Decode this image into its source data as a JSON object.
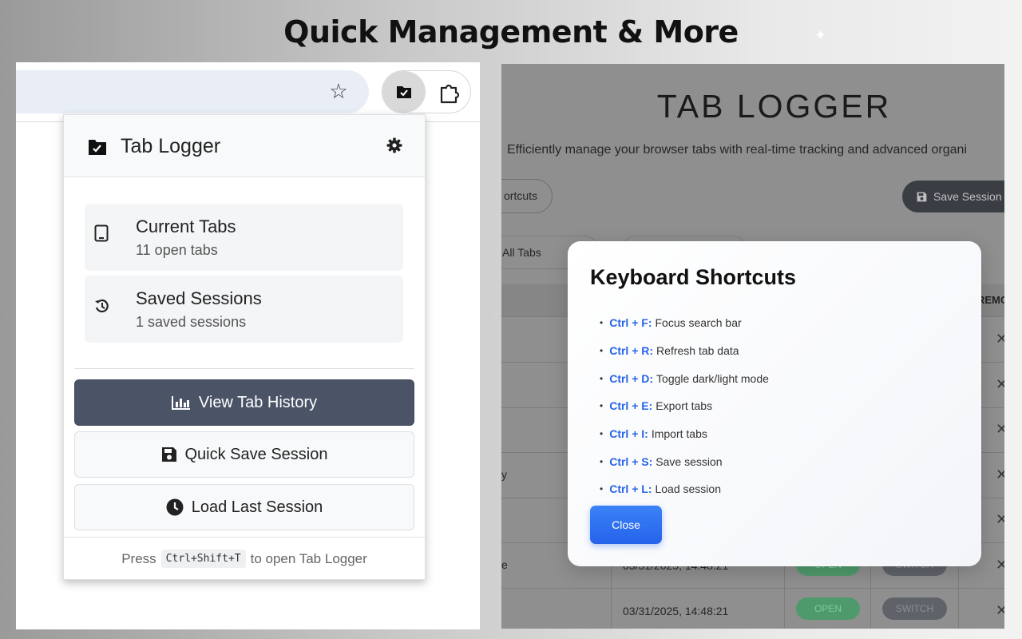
{
  "headline": "Quick Management & More",
  "browser": {
    "toolbar_icons": [
      "star-icon",
      "tab-logger-extension-icon",
      "puzzle-icon"
    ]
  },
  "popup": {
    "title": "Tab Logger",
    "cards": [
      {
        "title": "Current Tabs",
        "subtitle": "11 open tabs",
        "icon": "tablet-icon"
      },
      {
        "title": "Saved Sessions",
        "subtitle": "1 saved sessions",
        "icon": "history-icon"
      }
    ],
    "buttons": {
      "view_history": "View Tab History",
      "quick_save": "Quick Save Session",
      "load_last": "Load Last Session"
    },
    "footer": {
      "press": "Press",
      "shortcut": "Ctrl+Shift+T",
      "suffix": "to open Tab Logger"
    }
  },
  "app": {
    "title": "TAB LOGGER",
    "subtitle": "Efficiently manage your browser tabs with real-time tracking and advanced organi",
    "shortcuts_button": "ortcuts",
    "save_session_button": "Save Session",
    "filter_all": "All Tabs",
    "table_header_remove": "REMO",
    "row_fragments": {
      "row4": "y",
      "row6": "e"
    },
    "rows": [
      {
        "date": "03/31/2025, 14:48:21",
        "status": "OPEN",
        "action": "SWITCH"
      },
      {
        "date": "03/31/2025, 14:48:21",
        "status": "OPEN",
        "action": "SWITCH"
      }
    ],
    "remove_glyph": "✕"
  },
  "modal": {
    "title": "Keyboard Shortcuts",
    "shortcuts": [
      {
        "key": "Ctrl + F:",
        "action": "Focus search bar"
      },
      {
        "key": "Ctrl + R:",
        "action": "Refresh tab data"
      },
      {
        "key": "Ctrl + D:",
        "action": "Toggle dark/light mode"
      },
      {
        "key": "Ctrl + E:",
        "action": "Export tabs"
      },
      {
        "key": "Ctrl + I:",
        "action": "Import tabs"
      },
      {
        "key": "Ctrl + S:",
        "action": "Save session"
      },
      {
        "key": "Ctrl + L:",
        "action": "Load session"
      }
    ],
    "close_label": "Close"
  },
  "colors": {
    "accent_blue": "#2563eb",
    "dark_button": "#4a5466",
    "open_badge": "#4f9a6c",
    "switch_badge": "#5f6369"
  }
}
